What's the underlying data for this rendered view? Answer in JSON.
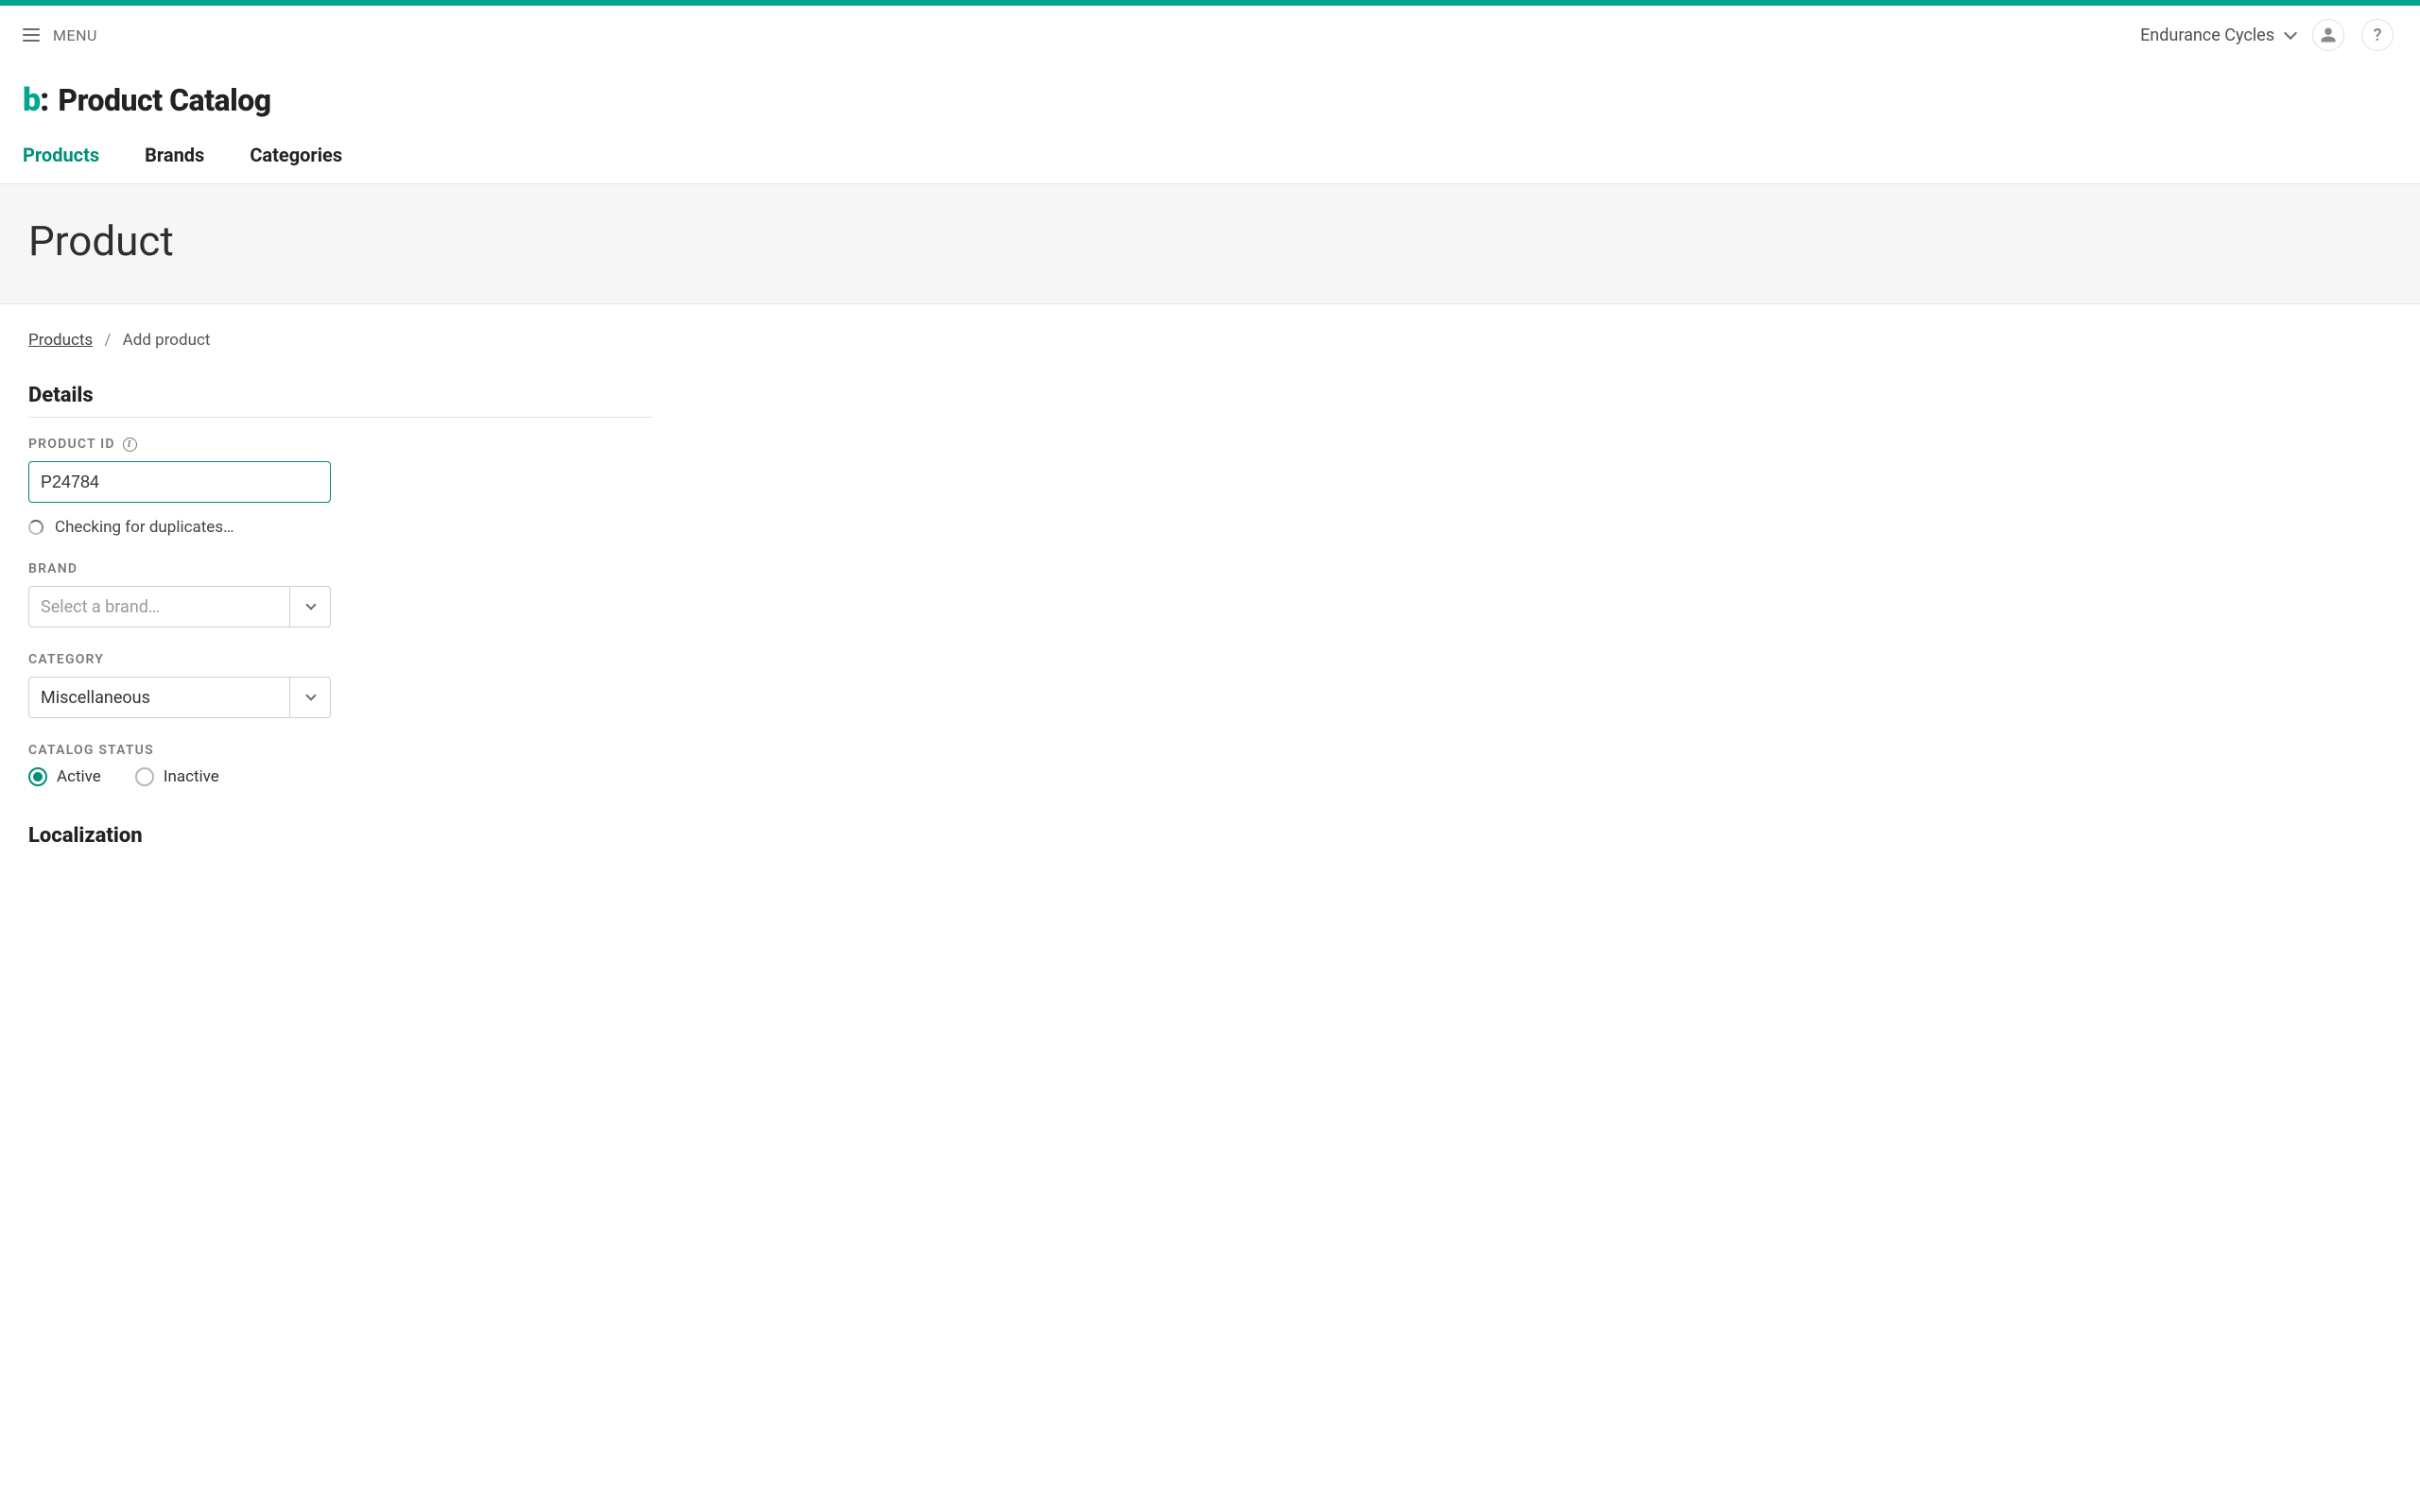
{
  "topbar": {
    "menu_label": "MENU",
    "tenant_name": "Endurance Cycles"
  },
  "header": {
    "logo_text": "b:",
    "page_title": "Product Catalog"
  },
  "tabs": [
    {
      "label": "Products",
      "active": true
    },
    {
      "label": "Brands",
      "active": false
    },
    {
      "label": "Categories",
      "active": false
    }
  ],
  "subheader": {
    "title": "Product"
  },
  "breadcrumb": {
    "root": "Products",
    "current": "Add product"
  },
  "sections": {
    "details_heading": "Details",
    "localization_heading": "Localization"
  },
  "fields": {
    "product_id": {
      "label": "PRODUCT ID",
      "value": "P24784",
      "status_text": "Checking for duplicates…"
    },
    "brand": {
      "label": "BRAND",
      "placeholder": "Select a brand…"
    },
    "category": {
      "label": "CATEGORY",
      "value": "Miscellaneous"
    },
    "catalog_status": {
      "label": "CATALOG STATUS",
      "options": [
        {
          "label": "Active",
          "selected": true
        },
        {
          "label": "Inactive",
          "selected": false
        }
      ]
    }
  }
}
